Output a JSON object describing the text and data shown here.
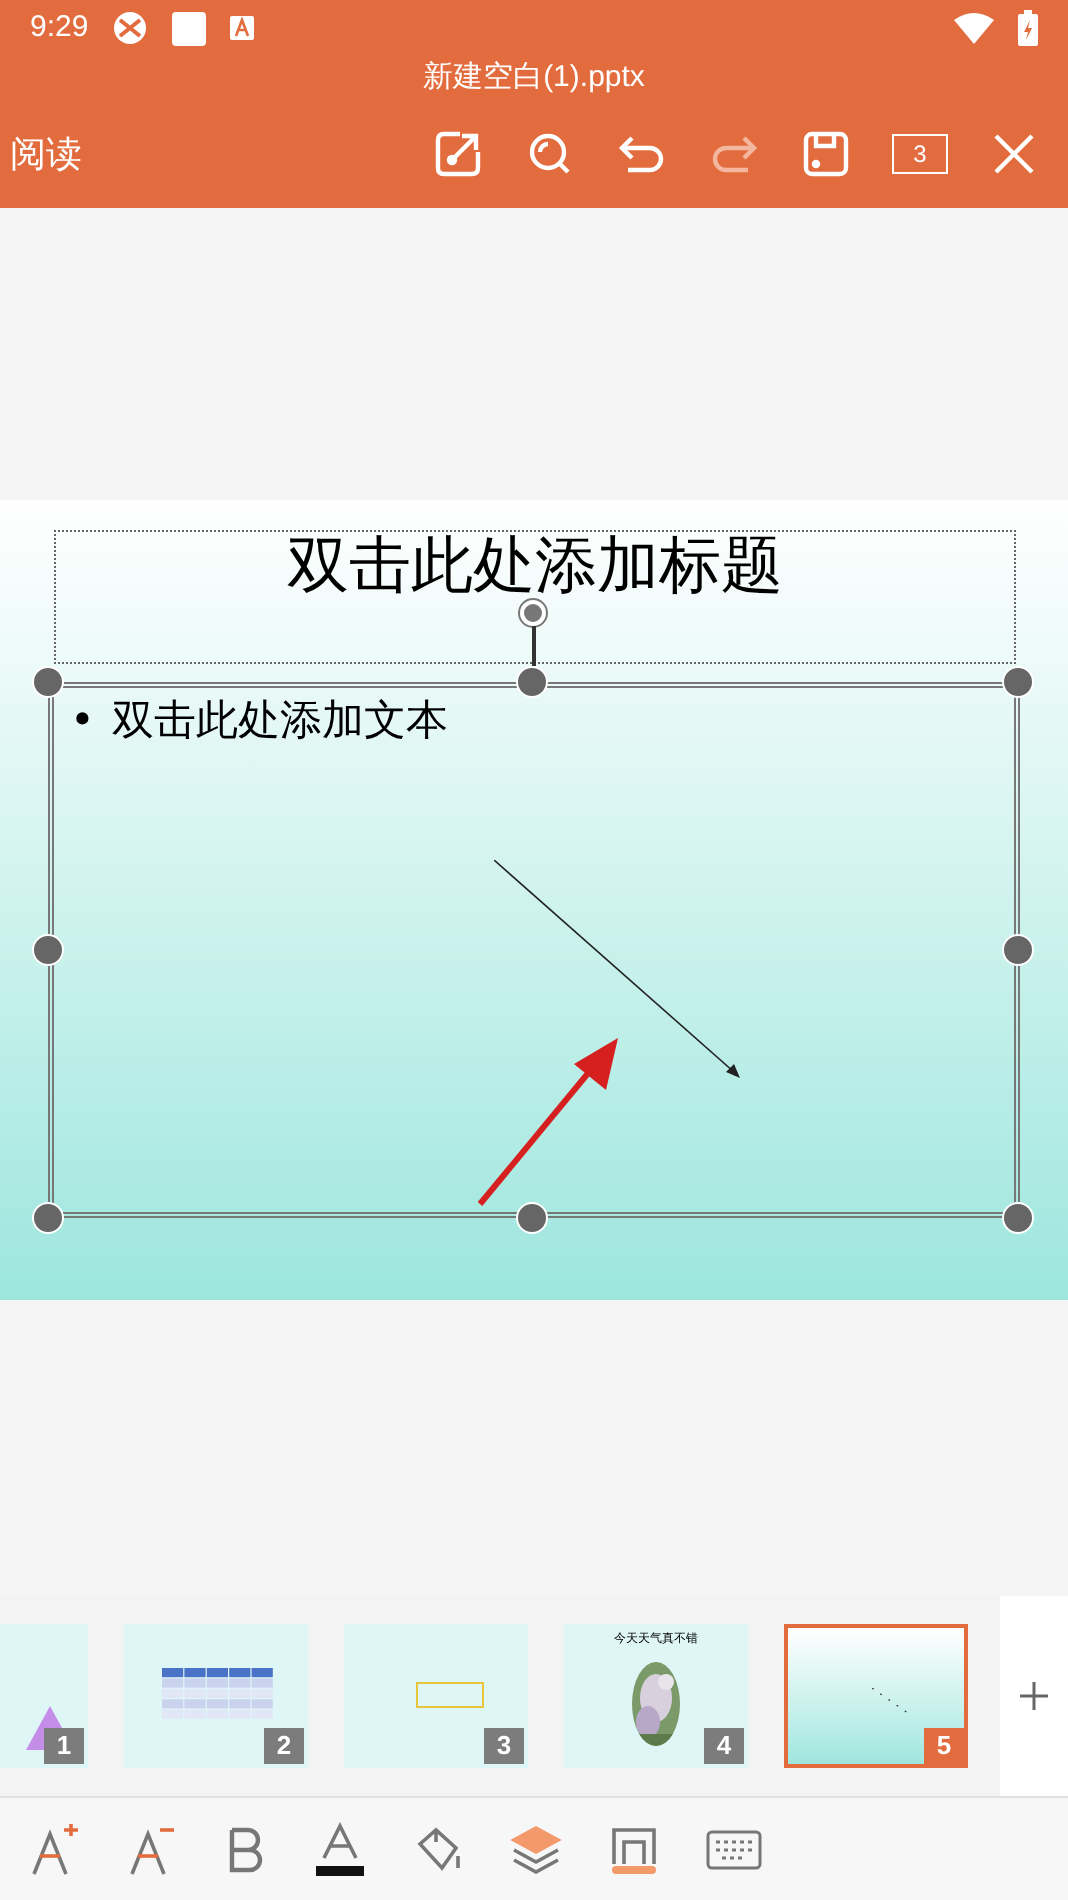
{
  "status_bar": {
    "time": "9:29"
  },
  "title": "新建空白(1).pptx",
  "toolbar": {
    "mode": "阅读",
    "page_count": "3"
  },
  "slide": {
    "title_placeholder": "双击此处添加标题",
    "bullet": "•",
    "body_placeholder": "双击此处添加文本"
  },
  "thumbnails": [
    {
      "number": "1",
      "selected": false,
      "kind": "shapes"
    },
    {
      "number": "2",
      "selected": false,
      "kind": "table"
    },
    {
      "number": "3",
      "selected": false,
      "kind": "textbox"
    },
    {
      "number": "4",
      "selected": false,
      "title": "今天天气真不错"
    },
    {
      "number": "5",
      "selected": true,
      "kind": "blank"
    }
  ]
}
